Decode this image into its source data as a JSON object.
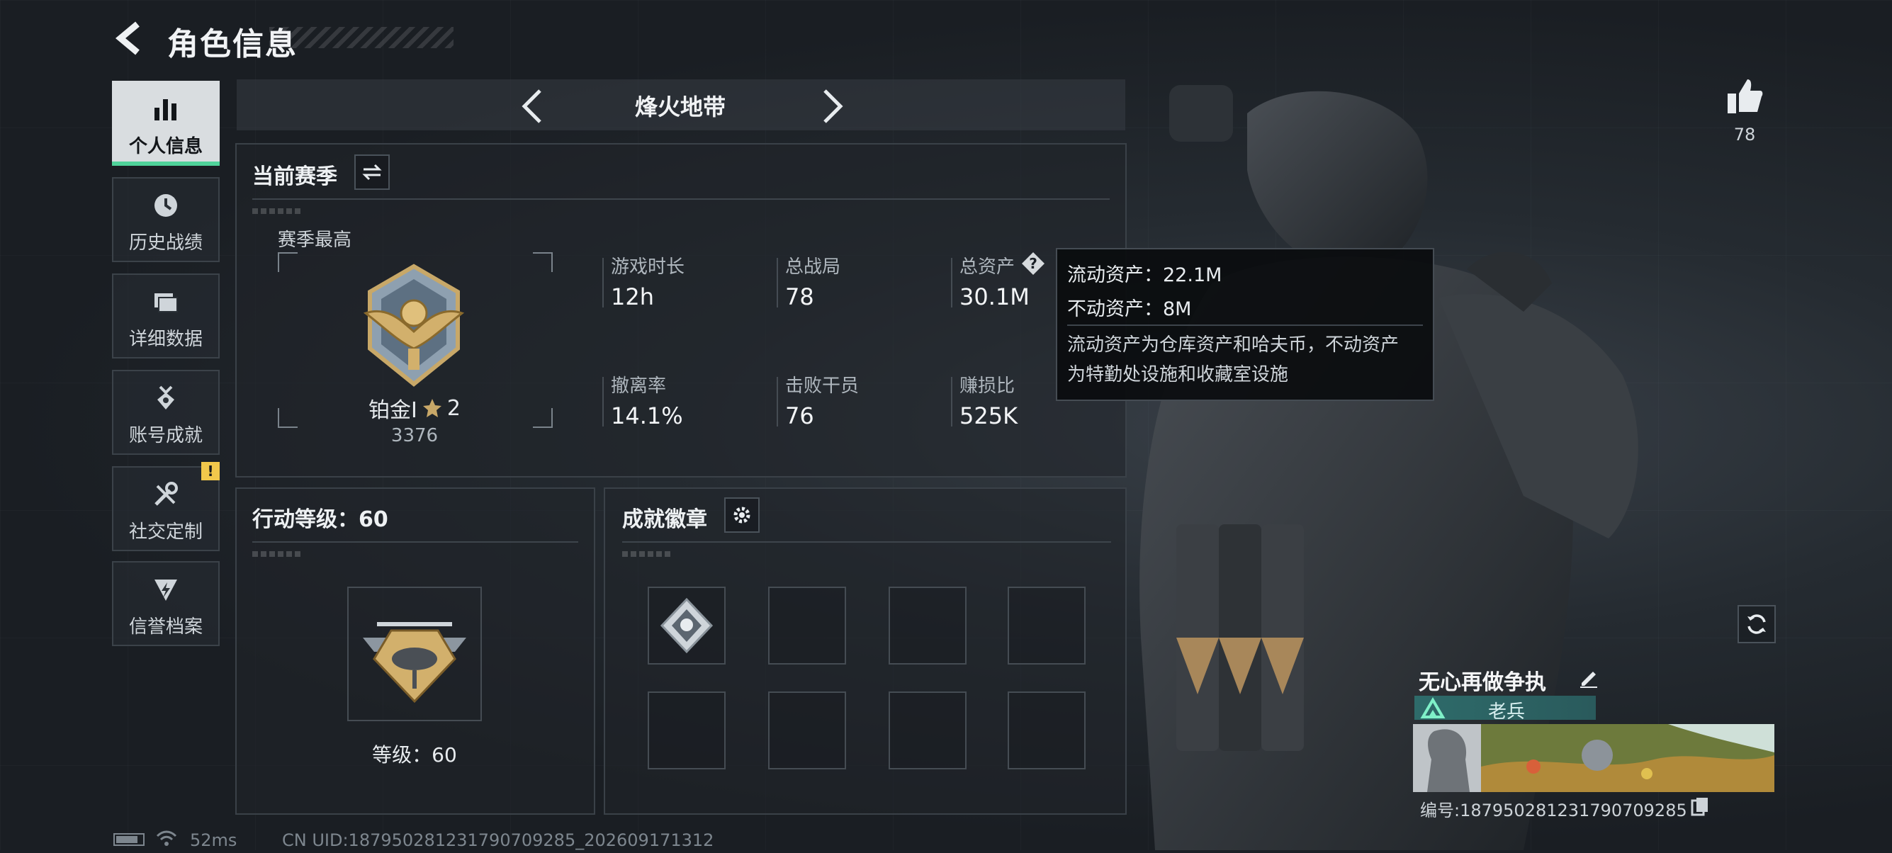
{
  "header": {
    "title": "角色信息"
  },
  "nav": {
    "items": [
      {
        "label": "个人信息",
        "icon": "bar-chart-icon",
        "active": true
      },
      {
        "label": "历史战绩",
        "icon": "clock-icon"
      },
      {
        "label": "详细数据",
        "icon": "folders-icon"
      },
      {
        "label": "账号成就",
        "icon": "medal-icon"
      },
      {
        "label": "社交定制",
        "icon": "tools-icon",
        "badge": "!"
      },
      {
        "label": "信誉档案",
        "icon": "shield-icon"
      }
    ]
  },
  "mode": {
    "name": "烽火地带"
  },
  "season": {
    "title": "当前赛季",
    "best_label": "赛季最高",
    "rank_name": "铂金Ⅰ",
    "rank_stars": "2",
    "rank_score": "3376",
    "stats": [
      {
        "label": "游戏时长",
        "value": "12h"
      },
      {
        "label": "总战局",
        "value": "78"
      },
      {
        "label": "总资产",
        "value": "30.1M"
      },
      {
        "label": "撤离率",
        "value": "14.1%"
      },
      {
        "label": "击败干员",
        "value": "76"
      },
      {
        "label": "赚损比",
        "value": "525K"
      }
    ]
  },
  "tooltip": {
    "liquid": "流动资产：22.1M",
    "fixed": "不动资产：8M",
    "note_line1": "流动资产为仓库资产和哈夫币，不动资产",
    "note_line2": "为特勤处设施和收藏室设施"
  },
  "action_level": {
    "title": "行动等级：60",
    "level_label": "等级：60"
  },
  "achievements": {
    "title": "成就徽章"
  },
  "likes": {
    "count": "78"
  },
  "profile": {
    "name": "无心再做争执",
    "rank_title": "老兵",
    "id_text": "编号:1879502812317907092​85"
  },
  "status_bar": {
    "ping": "52ms",
    "uid": "CN UID:187950281231790709285_202609171312"
  },
  "colors": {
    "accent_green": "#4fd39a",
    "warning": "#f2c84b",
    "rank_teal": "#2e6b6a"
  }
}
